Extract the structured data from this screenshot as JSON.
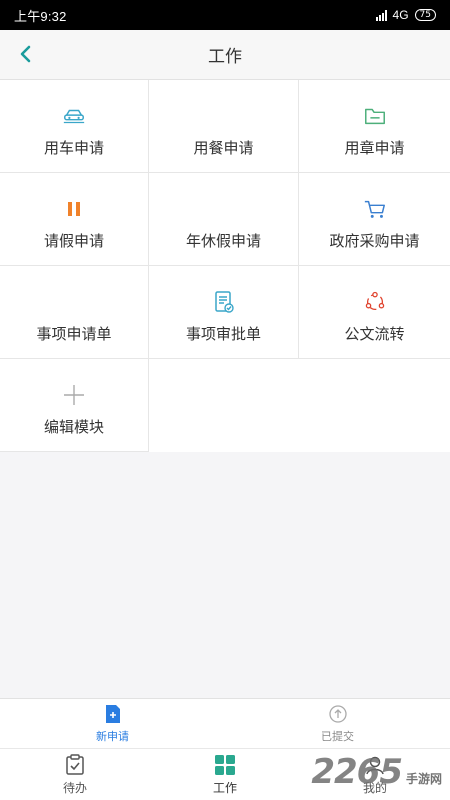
{
  "status_bar": {
    "time": "上午9:32",
    "network": "4G",
    "battery": "75"
  },
  "header": {
    "title": "工作"
  },
  "grid": {
    "items": [
      {
        "label": "用车申请",
        "icon": "car-icon"
      },
      {
        "label": "用餐申请",
        "icon": "dining-icon"
      },
      {
        "label": "用章申请",
        "icon": "folder-icon"
      },
      {
        "label": "请假申请",
        "icon": "pause-icon"
      },
      {
        "label": "年休假申请",
        "icon": ""
      },
      {
        "label": "政府采购申请",
        "icon": "cart-icon"
      },
      {
        "label": "事项申请单",
        "icon": ""
      },
      {
        "label": "事项审批单",
        "icon": "approval-doc-icon"
      },
      {
        "label": "公文流转",
        "icon": "flow-cycle-icon"
      },
      {
        "label": "编辑模块",
        "icon": "plus-icon"
      }
    ]
  },
  "sub_tabs": [
    {
      "label": "新申请",
      "icon": "new-application-icon",
      "active": true
    },
    {
      "label": "已提交",
      "icon": "submitted-icon",
      "active": false
    }
  ],
  "bottom_nav": [
    {
      "label": "待办",
      "icon": "clipboard-icon"
    },
    {
      "label": "工作",
      "icon": "grid-icon"
    },
    {
      "label": "我的",
      "icon": "profile-icon"
    }
  ],
  "watermark": {
    "number": "2265",
    "text": "手游网"
  },
  "colors": {
    "accent_teal": "#1a9c9c",
    "active_blue": "#2a7de1",
    "orange": "#f0822b",
    "green": "#4caf7a",
    "red": "#e0442f"
  }
}
